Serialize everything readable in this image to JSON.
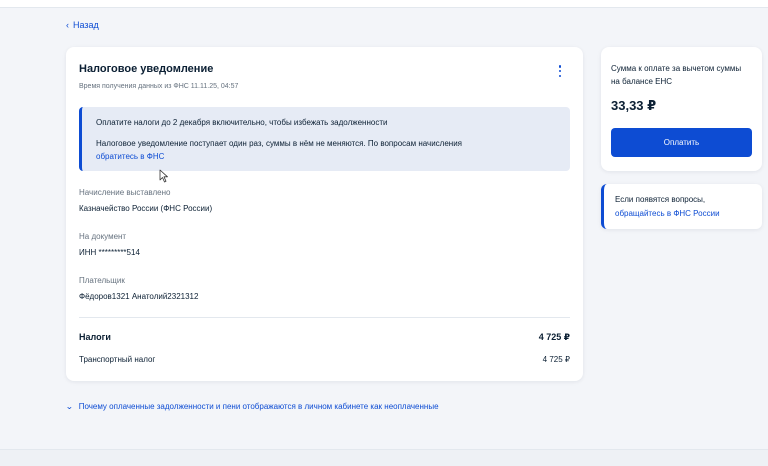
{
  "nav": {
    "back_label": "Назад"
  },
  "notice": {
    "title": "Налоговое уведомление",
    "subtitle": "Время получения данных из ФНС 11.11.25, 04:57",
    "alert": {
      "line1": "Оплатите налоги до 2 декабря включительно, чтобы избежать задолженности",
      "line2": "Налоговое уведомление поступает один раз, суммы в нём не меняются. По вопросам начисления",
      "link": "обратитесь в ФНС"
    },
    "fields": [
      {
        "label": "Начисление выставлено",
        "value": "Казначейство России (ФНС России)"
      },
      {
        "label": "На документ",
        "value": "ИНН *********514"
      },
      {
        "label": "Плательщик",
        "value": "Фёдоров1321 Анатолий2321312"
      }
    ],
    "taxes": {
      "label": "Налоги",
      "total": "4 725 ₽",
      "items": [
        {
          "name": "Транспортный налог",
          "amount": "4 725 ₽"
        }
      ]
    }
  },
  "payment": {
    "label": "Сумма к оплате за вычетом суммы на балансе ЕНС",
    "amount": "33,33 ₽",
    "button_label": "Оплатить"
  },
  "help": {
    "line1": "Если появятся вопросы,",
    "link": "обращайтесь в ФНС России"
  },
  "faq": {
    "label": "Почему оплаченные задолженности и пени отображаются в личном кабинете как неоплаченные"
  },
  "colors": {
    "accent": "#0d4cd3",
    "background": "#f3f5f9",
    "alert_bg": "#e6ebf5",
    "text": "#0b1f33",
    "muted": "#66727f"
  }
}
